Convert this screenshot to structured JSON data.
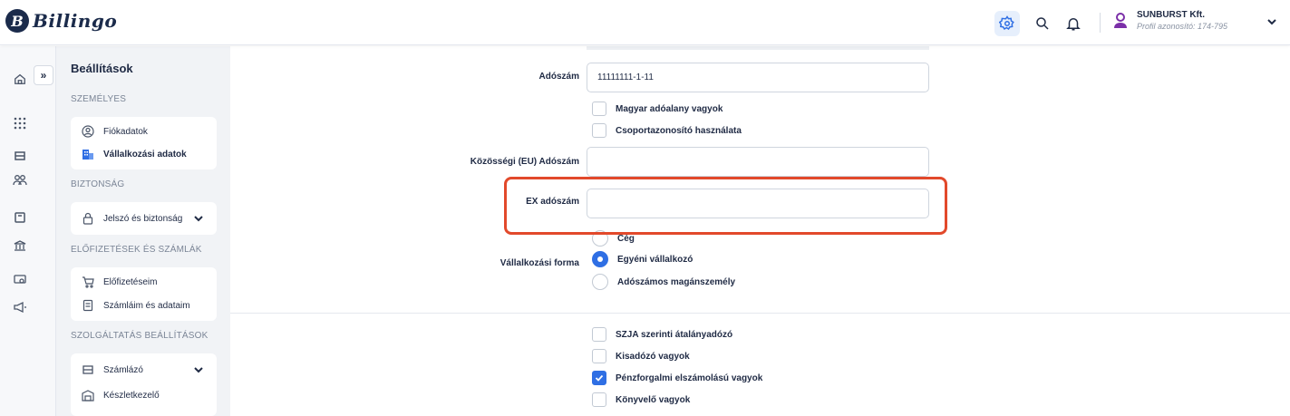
{
  "app": {
    "logo_text": "Billingo",
    "logo_letter": "B"
  },
  "topbar": {
    "profile_name": "SUNBURST Kft.",
    "profile_sub": "Profil azonosító: 174-795",
    "icons": [
      "settings-icon",
      "search-icon",
      "bell-icon",
      "user-icon",
      "chevron-down-icon"
    ]
  },
  "rail": {
    "expand_label": "»"
  },
  "nav": {
    "title": "Beállítások",
    "sections": {
      "personal": "SZEMÉLYES",
      "security": "BIZTONSÁG",
      "subscriptions": "ELŐFIZETÉSEK ÉS SZÁMLÁK",
      "services": "SZOLGÁLTATÁS BEÁLLÍTÁSOK"
    },
    "items": {
      "account": "Fiókadatok",
      "business": "Vállalkozási adatok",
      "password": "Jelszó és biztonság",
      "my_subscriptions": "Előfizetéseim",
      "invoices": "Számláim és adataim",
      "invoicer": "Számlázó",
      "inventory": "Készletkezelő"
    }
  },
  "form": {
    "tax_label": "Adószám",
    "tax_value": "11111111-1-11",
    "hu_taxpayer": "Magyar adóalany vagyok",
    "group_id": "Csoportazonosító használata",
    "eu_label": "Közösségi (EU) Adószám",
    "eu_value": "",
    "ex_label": "EX adószám",
    "ex_value": "",
    "business_form_label": "Vállalkozási forma",
    "business_forms": [
      "Cég",
      "Egyéni vállalkozó",
      "Adószámos magánszemély"
    ],
    "business_form_selected": "Egyéni vállalkozó",
    "options": [
      {
        "label": "SZJA szerinti átalányadózó",
        "checked": false
      },
      {
        "label": "Kisadózó vagyok",
        "checked": false
      },
      {
        "label": "Pénzforgalmi elszámolású vagyok",
        "checked": true
      },
      {
        "label": "Könyvelő vagyok",
        "checked": false
      }
    ]
  },
  "colors": {
    "accent": "#2f6fe4",
    "highlight": "#e2492b",
    "brand": "#1b2b4b"
  }
}
